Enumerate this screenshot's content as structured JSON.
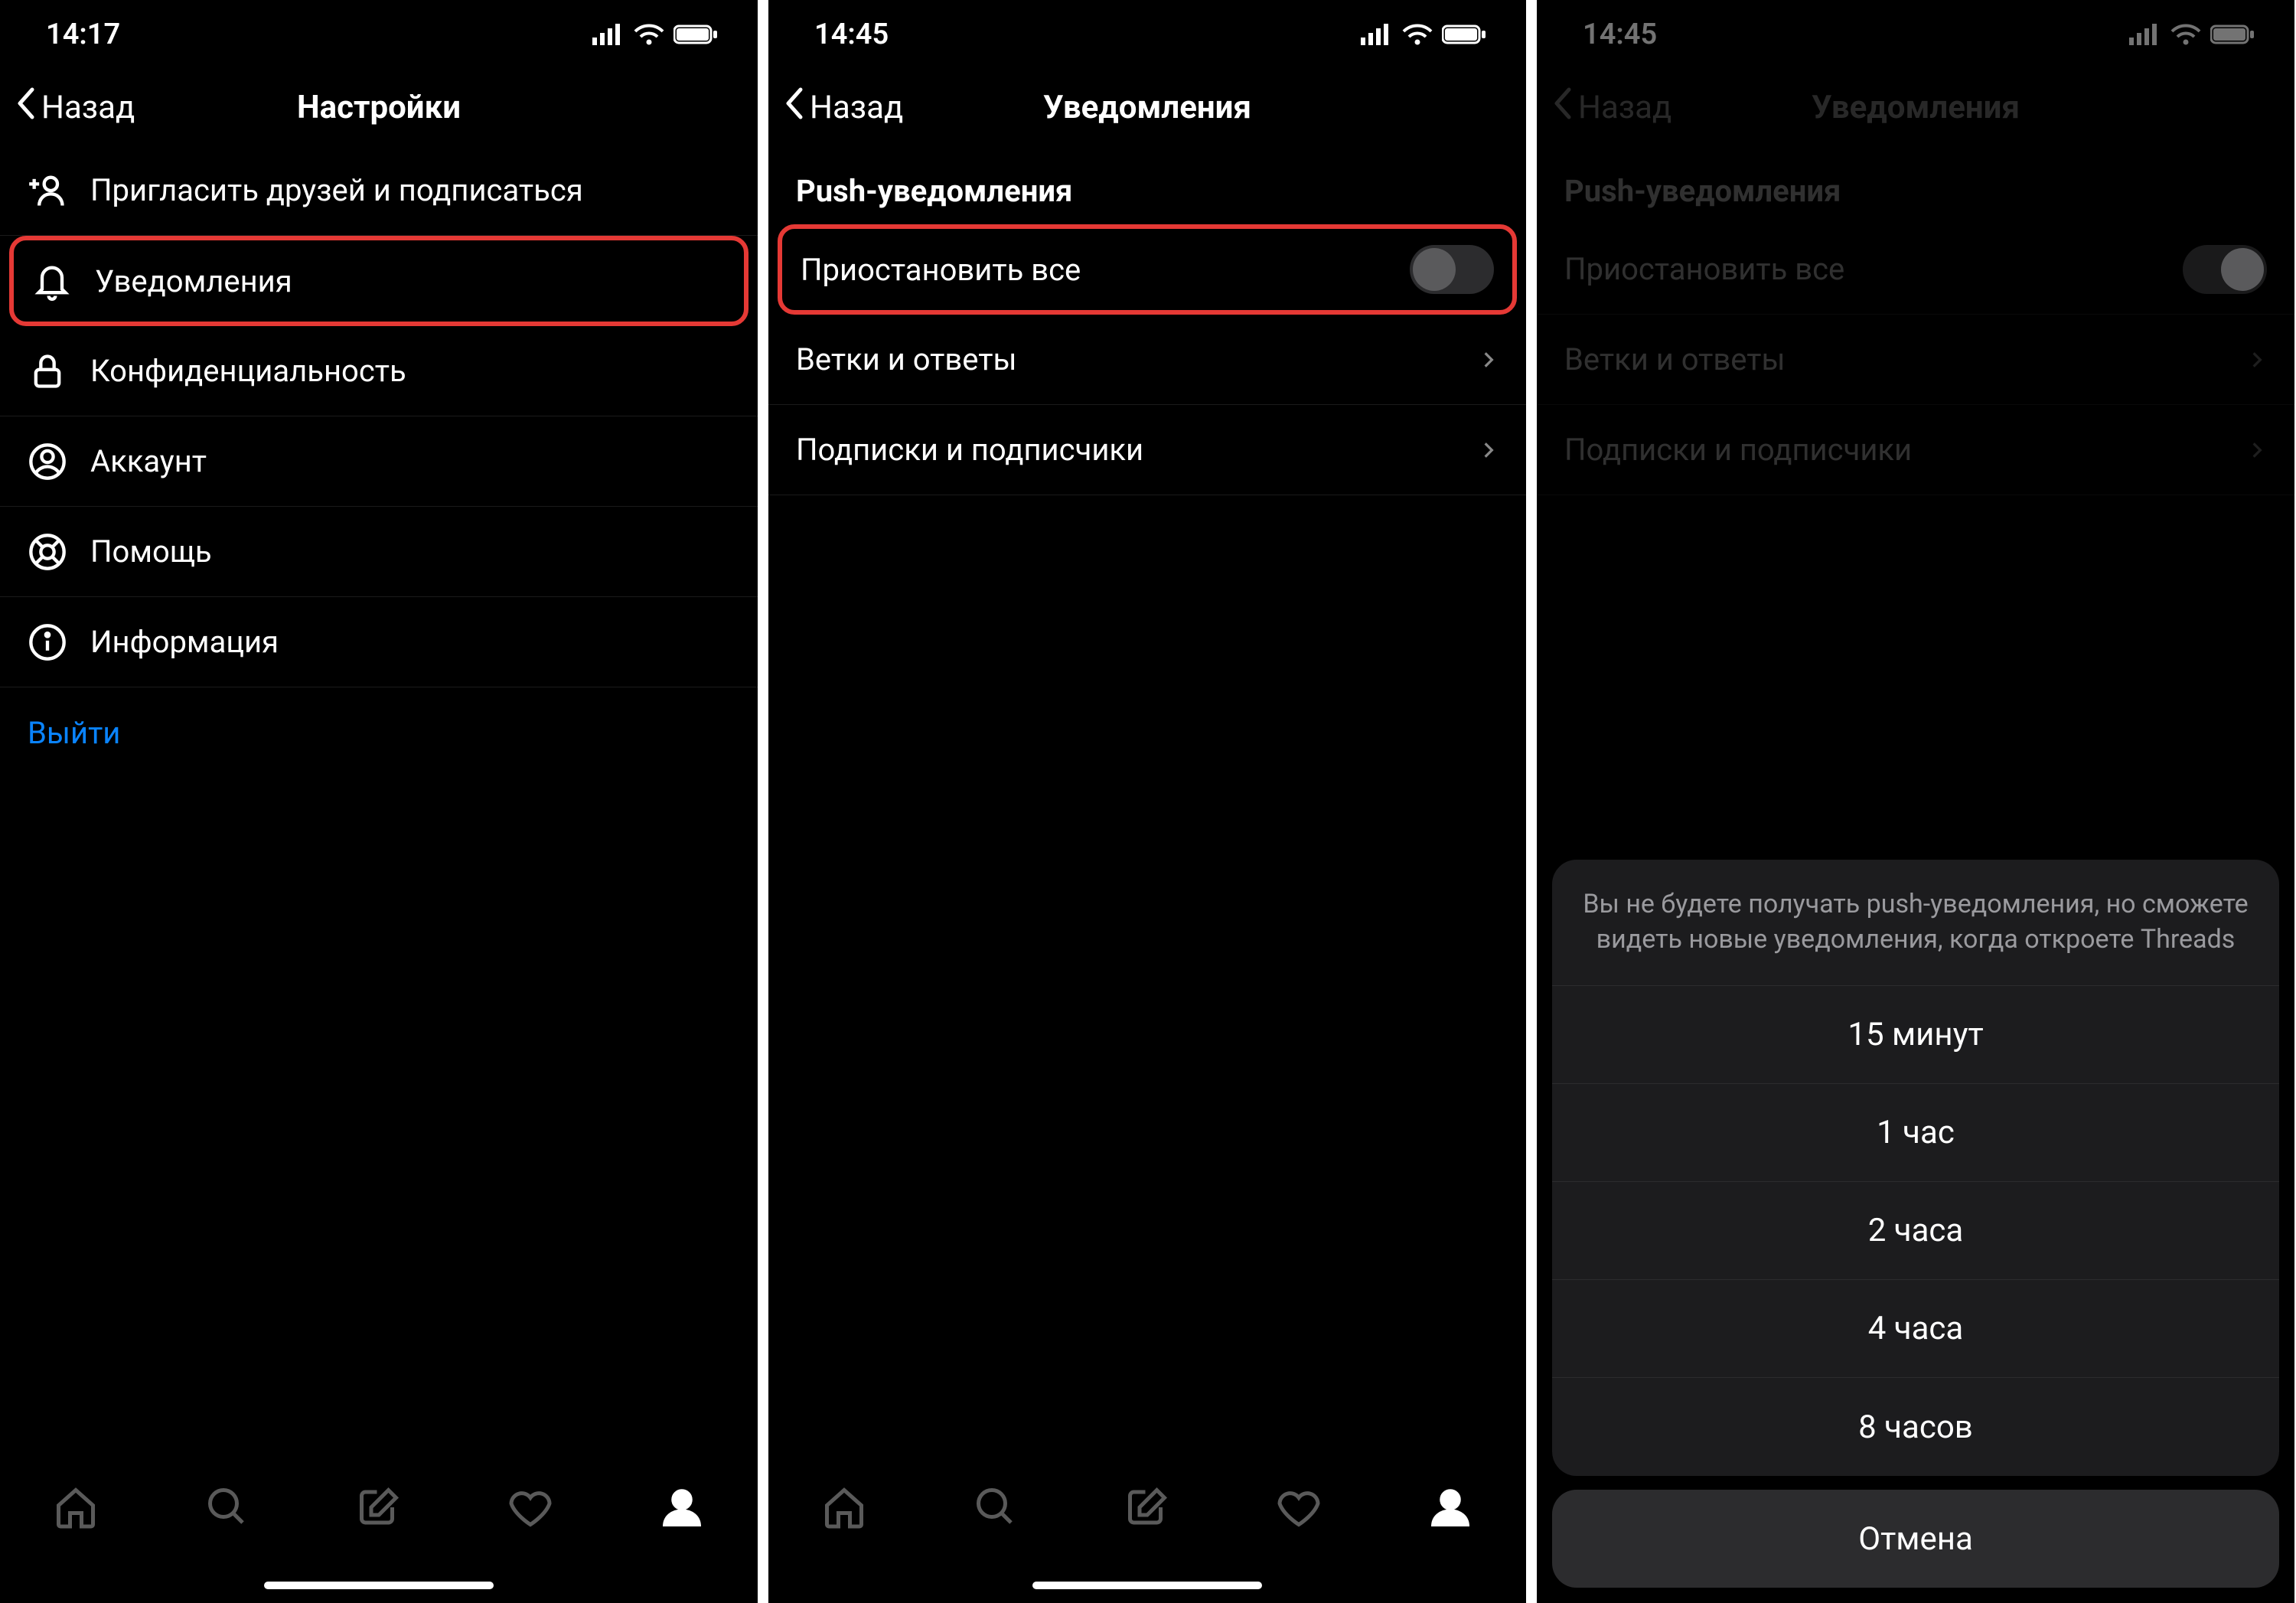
{
  "screen1": {
    "time": "14:17",
    "back": "Назад",
    "title": "Настройки",
    "items": {
      "invite": "Пригласить друзей и подписаться",
      "notify": "Уведомления",
      "privacy": "Конфиденциальность",
      "account": "Аккаунт",
      "help": "Помощь",
      "info": "Информация"
    },
    "logout": "Выйти"
  },
  "screen2": {
    "time": "14:45",
    "back": "Назад",
    "title": "Уведомления",
    "section": "Push-уведомления",
    "rows": {
      "pause": "Приостановить все",
      "threads": "Ветки и ответы",
      "follows": "Подписки и подписчики"
    }
  },
  "screen3": {
    "time": "14:45",
    "back": "Назад",
    "title": "Уведомления",
    "section": "Push-уведомления",
    "rows": {
      "pause": "Приостановить все",
      "threads": "Ветки и ответы",
      "follows": "Подписки и подписчики"
    },
    "sheet": {
      "desc": "Вы не будете получать push-уведомления, но сможете видеть новые уведомления, когда откроете Threads",
      "options": {
        "o1": "15 минут",
        "o2": "1 час",
        "o3": "2 часа",
        "o4": "4 часа",
        "o5": "8 часов"
      },
      "cancel": "Отмена"
    }
  }
}
